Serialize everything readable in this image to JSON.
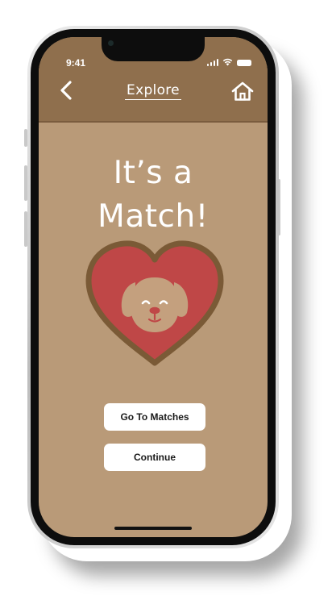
{
  "status_bar": {
    "time": "9:41"
  },
  "nav": {
    "title": "Explore",
    "back_icon": "chevron-left-icon",
    "home_icon": "home-icon"
  },
  "match": {
    "title": "It’s a\nMatch!",
    "illustration": "dog-face-heart"
  },
  "buttons": {
    "go_to_matches": "Go To Matches",
    "continue": "Continue"
  },
  "colors": {
    "header": "#8f6f4d",
    "background": "#b99a78",
    "heart_fill": "#bf4747",
    "heart_outline": "#7a5a36",
    "dog": "#c4a07e",
    "button": "#ffffff"
  }
}
